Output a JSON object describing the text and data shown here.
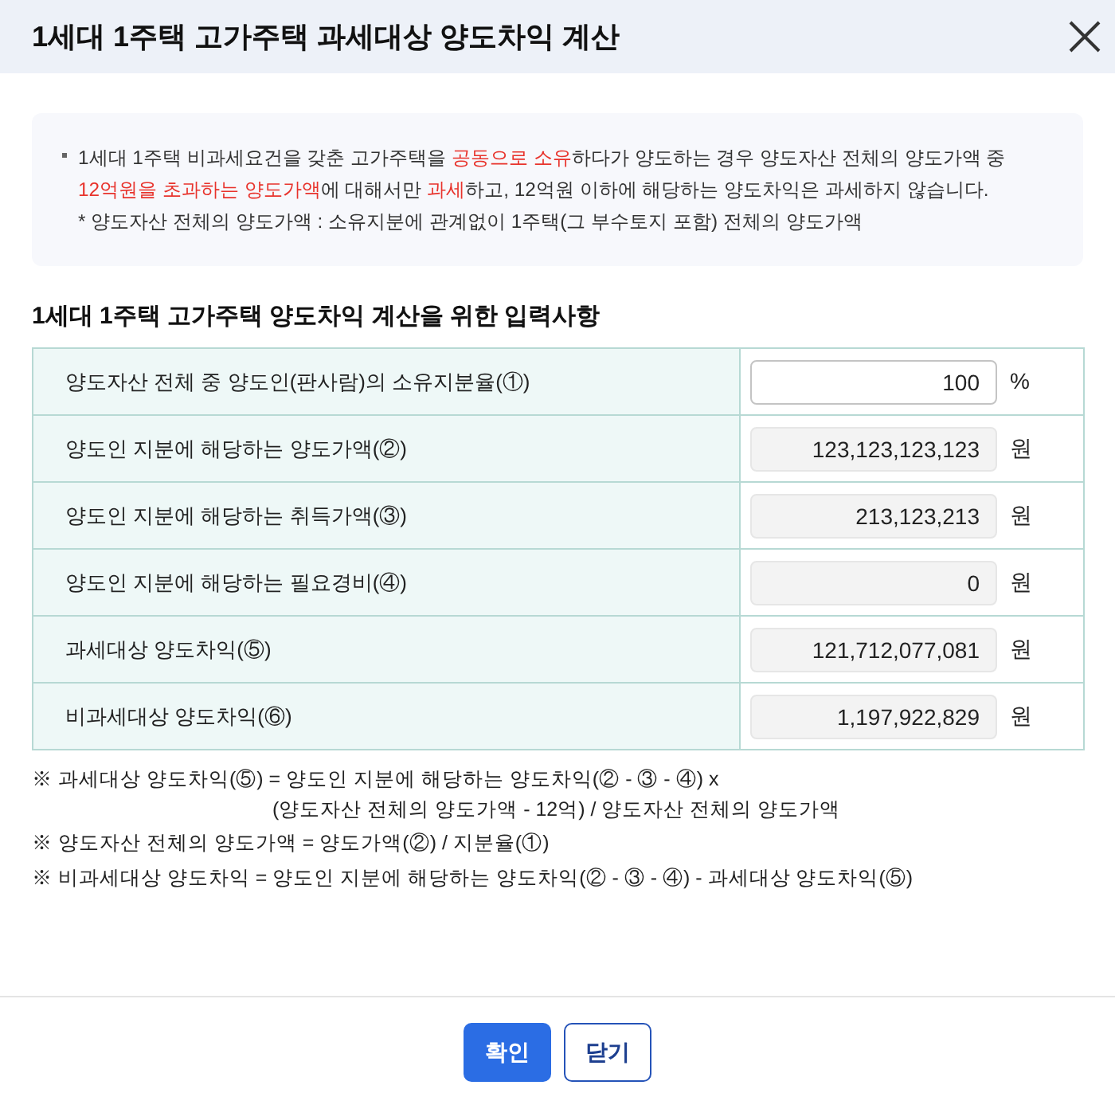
{
  "dialog": {
    "title": "1세대 1주택 고가주택 과세대상 양도차익 계산"
  },
  "notice": {
    "segments": [
      {
        "text": "1세대 1주택 비과세요건을 갖춘 고가주택을 ",
        "highlight": false
      },
      {
        "text": "공동으로 소유",
        "highlight": true
      },
      {
        "text": "하다가 양도하는 경우 양도자산 전체의 양도가액 중 ",
        "highlight": false
      },
      {
        "text": "12억원을 초과하는 양도가액",
        "highlight": true
      },
      {
        "text": "에 대해서만 ",
        "highlight": false
      },
      {
        "text": "과세",
        "highlight": true
      },
      {
        "text": "하고, 12억원 이하에 해당하는 양도차익은 과세하지 않습니다.",
        "highlight": false
      }
    ],
    "footnote": "* 양도자산 전체의 양도가액 : 소유지분에 관계없이 1주택(그 부수토지 포함) 전체의 양도가액"
  },
  "section": {
    "title": "1세대 1주택 고가주택 양도차익 계산을 위한 입력사항"
  },
  "rows": [
    {
      "label": "양도자산 전체 중 양도인(판사람)의 소유지분율(①)",
      "value": "100",
      "unit": "%",
      "editable": true
    },
    {
      "label": "양도인 지분에 해당하는 양도가액(②)",
      "value": "123,123,123,123",
      "unit": "원",
      "editable": false
    },
    {
      "label": "양도인 지분에 해당하는 취득가액(③)",
      "value": "213,123,213",
      "unit": "원",
      "editable": false
    },
    {
      "label": "양도인 지분에 해당하는 필요경비(④)",
      "value": "0",
      "unit": "원",
      "editable": false
    },
    {
      "label": "과세대상 양도차익(⑤)",
      "value": "121,712,077,081",
      "unit": "원",
      "editable": false
    },
    {
      "label": "비과세대상 양도차익(⑥)",
      "value": "1,197,922,829",
      "unit": "원",
      "editable": false
    }
  ],
  "notes": [
    {
      "text": "※ 과세대상 양도차익(⑤) = 양도인 지분에 해당하는 양도차익(② - ③ - ④) x",
      "continuation": "(양도자산 전체의 양도가액 - 12억) / 양도자산 전체의 양도가액"
    },
    {
      "text": "※ 양도자산 전체의 양도가액 = 양도가액(②) / 지분율(①)"
    },
    {
      "text": "※ 비과세대상 양도차익 = 양도인 지분에 해당하는 양도차익(② - ③ - ④) - 과세대상 양도차익(⑤)"
    }
  ],
  "buttons": [
    {
      "label": "확인",
      "kind": "primary"
    },
    {
      "label": "닫기",
      "kind": "secondary"
    }
  ]
}
